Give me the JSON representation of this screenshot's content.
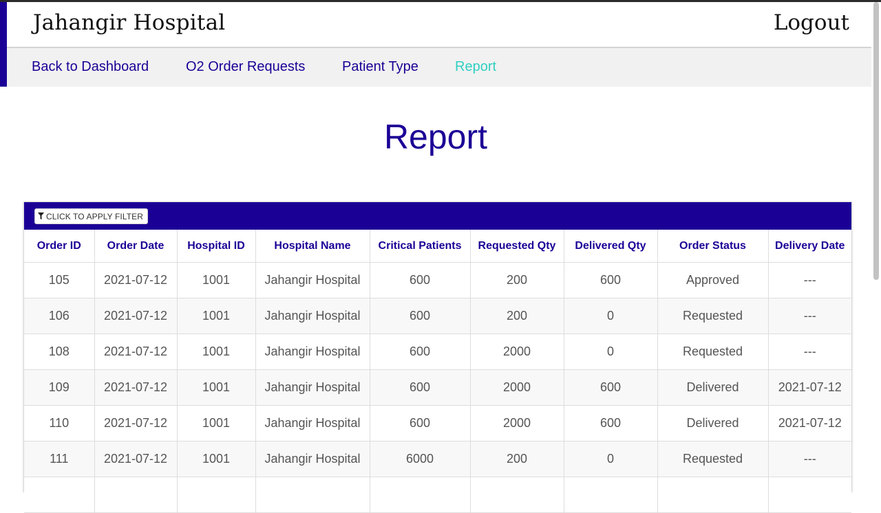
{
  "header": {
    "brand": "Jahangir Hospital",
    "logout_label": "Logout"
  },
  "nav": {
    "items": [
      {
        "label": "Back to Dashboard"
      },
      {
        "label": "O2 Order Requests"
      },
      {
        "label": "Patient Type"
      },
      {
        "label": "Report",
        "active": true
      }
    ]
  },
  "page": {
    "title": "Report"
  },
  "toolbar": {
    "filter_label": "CLICK TO APPLY FILTER",
    "filter_icon": "filter-icon"
  },
  "table": {
    "columns": [
      "Order ID",
      "Order Date",
      "Hospital ID",
      "Hospital Name",
      "Critical Patients",
      "Requested Qty",
      "Delivered Qty",
      "Order Status",
      "Delivery Date"
    ],
    "rows": [
      [
        "105",
        "2021-07-12",
        "1001",
        "Jahangir Hospital",
        "600",
        "200",
        "600",
        "Approved",
        "---"
      ],
      [
        "106",
        "2021-07-12",
        "1001",
        "Jahangir Hospital",
        "600",
        "200",
        "0",
        "Requested",
        "---"
      ],
      [
        "108",
        "2021-07-12",
        "1001",
        "Jahangir Hospital",
        "600",
        "2000",
        "0",
        "Requested",
        "---"
      ],
      [
        "109",
        "2021-07-12",
        "1001",
        "Jahangir Hospital",
        "600",
        "2000",
        "600",
        "Delivered",
        "2021-07-12"
      ],
      [
        "110",
        "2021-07-12",
        "1001",
        "Jahangir Hospital",
        "600",
        "2000",
        "600",
        "Delivered",
        "2021-07-12"
      ],
      [
        "111",
        "2021-07-12",
        "1001",
        "Jahangir Hospital",
        "6000",
        "200",
        "0",
        "Requested",
        "---"
      ],
      [
        "",
        "",
        "",
        "",
        "",
        "",
        "",
        "",
        ""
      ]
    ]
  },
  "colors": {
    "brand_blue": "#1b0096",
    "active_teal": "#2fd0c1",
    "nav_bg": "#f1f1f1"
  }
}
